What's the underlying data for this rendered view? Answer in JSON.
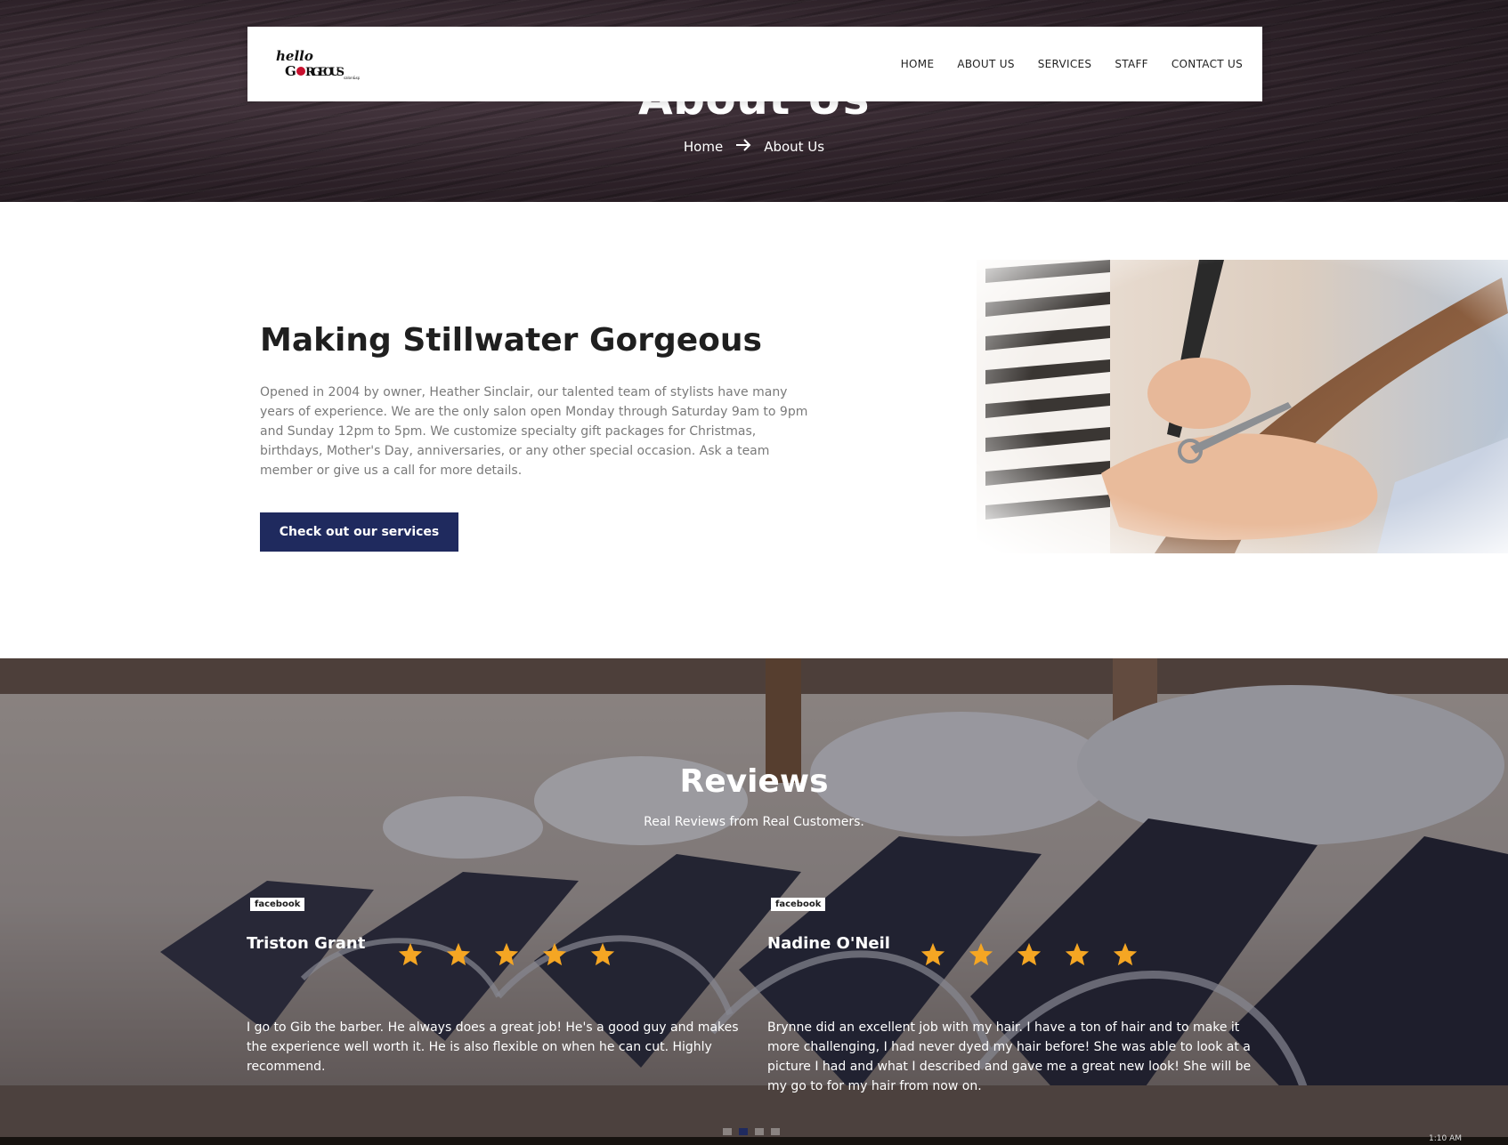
{
  "hero": {
    "title": "About Us",
    "breadcrumb": {
      "home": "Home",
      "current": "About Us"
    }
  },
  "nav": {
    "logo_alt": "hello GORGEOUS salon & spa",
    "links": [
      "HOME",
      "ABOUT US",
      "SERVICES",
      "STAFF",
      "CONTACT US"
    ]
  },
  "about": {
    "heading": "Making Stillwater Gorgeous",
    "body": "Opened in 2004 by owner, Heather Sinclair, our talented team of stylists have many years of experience. We are the only salon open Monday through Saturday 9am to 9pm and Sunday 12pm to 5pm. We customize specialty gift packages for Christmas, birthdays, Mother's Day, anniversaries, or any other special occasion. Ask a team member or give us a call for more details.",
    "cta_label": "Check out our services"
  },
  "reviews": {
    "title": "Reviews",
    "subtitle": "Real Reviews from Real Customers.",
    "items": [
      {
        "source": "facebook",
        "name": "Triston Grant",
        "rating": 5,
        "text": "I go to Gib the barber. He always does a great job! He's a good guy and makes the experience well worth it. He is also flexible on when he can cut. Highly recommend."
      },
      {
        "source": "facebook",
        "name": "Nadine O'Neil",
        "rating": 5,
        "text": "Brynne did an excellent job with my hair. I have a ton of hair and to make it more challenging, I had never dyed my hair before! She was able to look at a picture I had and what I described and gave me a great new look! She will be my go to for my hair from now on."
      }
    ],
    "carousel_active_index": 1,
    "carousel_count": 4
  },
  "colors": {
    "accent": "#1f2a5e",
    "star": "#f5a623",
    "hero_bg": "#2e2229"
  },
  "icons": {
    "breadcrumb_separator": "arrow-right-icon",
    "rating": "star-icon"
  },
  "taskbar": {
    "clock": "1:10 AM"
  }
}
